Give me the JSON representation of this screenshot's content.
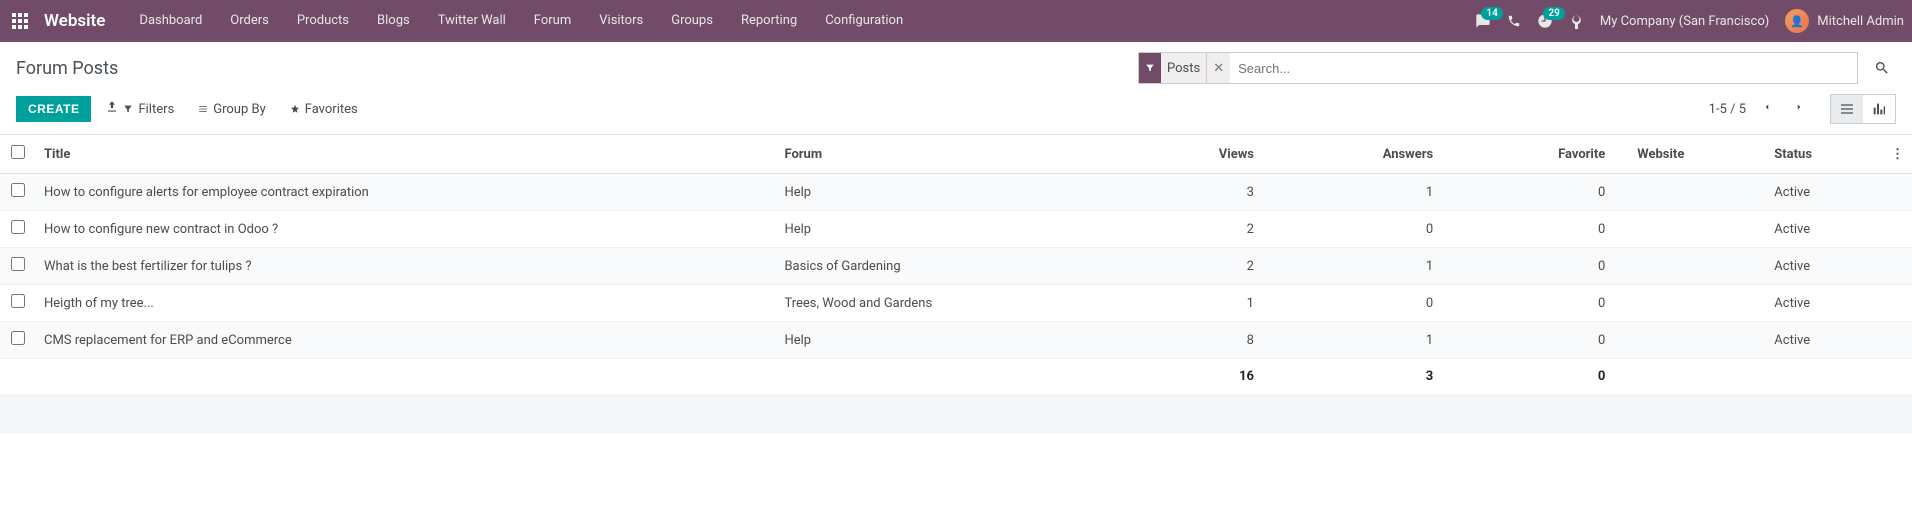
{
  "nav": {
    "brand": "Website",
    "items": [
      "Dashboard",
      "Orders",
      "Products",
      "Blogs",
      "Twitter Wall",
      "Forum",
      "Visitors",
      "Groups",
      "Reporting",
      "Configuration"
    ],
    "messages_badge": "14",
    "activities_badge": "29",
    "company": "My Company (San Francisco)",
    "user": "Mitchell Admin"
  },
  "page": {
    "title": "Forum Posts",
    "create_label": "CREATE"
  },
  "search": {
    "facet_label": "Posts",
    "placeholder": "Search..."
  },
  "filters": {
    "filters_label": "Filters",
    "groupby_label": "Group By",
    "favorites_label": "Favorites"
  },
  "pager": {
    "text": "1-5 / 5"
  },
  "columns": {
    "title": "Title",
    "forum": "Forum",
    "views": "Views",
    "answers": "Answers",
    "favorite": "Favorite",
    "website": "Website",
    "status": "Status"
  },
  "rows": [
    {
      "title": "How to configure alerts for employee contract expiration",
      "forum": "Help",
      "views": "3",
      "answers": "1",
      "favorite": "0",
      "website": "",
      "status": "Active"
    },
    {
      "title": "How to configure new contract in Odoo ?",
      "forum": "Help",
      "views": "2",
      "answers": "0",
      "favorite": "0",
      "website": "",
      "status": "Active"
    },
    {
      "title": "What is the best fertilizer for tulips ?",
      "forum": "Basics of Gardening",
      "views": "2",
      "answers": "1",
      "favorite": "0",
      "website": "",
      "status": "Active"
    },
    {
      "title": "Heigth of my tree...",
      "forum": "Trees, Wood and Gardens",
      "views": "1",
      "answers": "0",
      "favorite": "0",
      "website": "",
      "status": "Active"
    },
    {
      "title": "CMS replacement for ERP and eCommerce",
      "forum": "Help",
      "views": "8",
      "answers": "1",
      "favorite": "0",
      "website": "",
      "status": "Active"
    }
  ],
  "totals": {
    "views": "16",
    "answers": "3",
    "favorite": "0"
  }
}
